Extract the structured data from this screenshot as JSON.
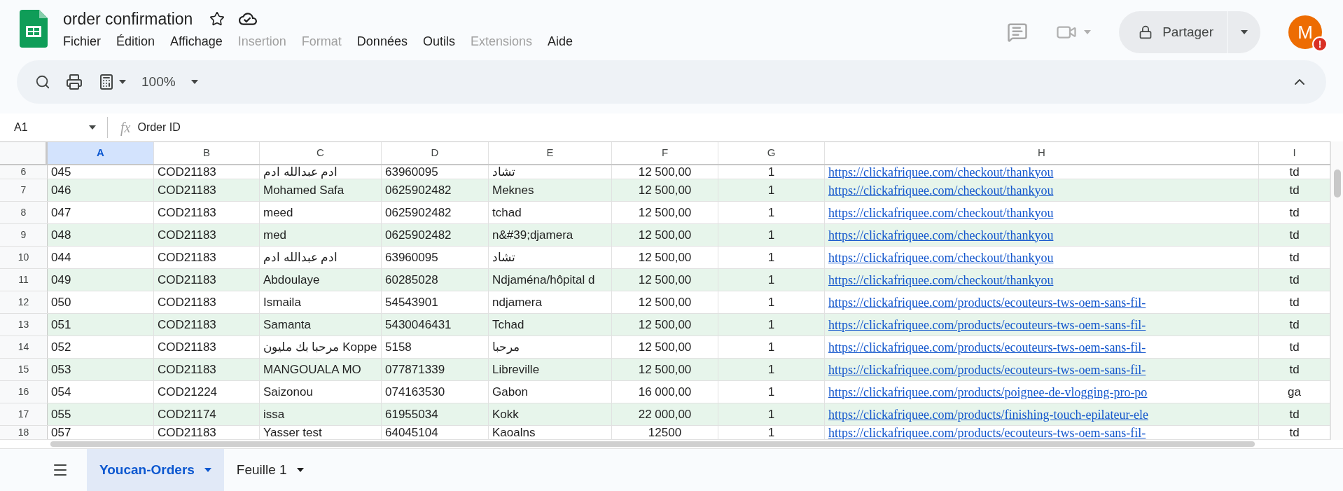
{
  "document": {
    "title": "order confirmation"
  },
  "menu": [
    {
      "label": "Fichier",
      "disabled": false
    },
    {
      "label": "Édition",
      "disabled": false
    },
    {
      "label": "Affichage",
      "disabled": false
    },
    {
      "label": "Insertion",
      "disabled": true
    },
    {
      "label": "Format",
      "disabled": true
    },
    {
      "label": "Données",
      "disabled": false
    },
    {
      "label": "Outils",
      "disabled": false
    },
    {
      "label": "Extensions",
      "disabled": true
    },
    {
      "label": "Aide",
      "disabled": false
    }
  ],
  "share_button": {
    "label": "Partager"
  },
  "account": {
    "initial": "M",
    "alert": "!"
  },
  "toolbar": {
    "zoom": "100%"
  },
  "formula_bar": {
    "cell": "A1",
    "fx": "fx",
    "value": "Order ID"
  },
  "columns": [
    {
      "label": "A",
      "selected": true
    },
    {
      "label": "B",
      "selected": false
    },
    {
      "label": "C",
      "selected": false
    },
    {
      "label": "D",
      "selected": false
    },
    {
      "label": "E",
      "selected": false
    },
    {
      "label": "F",
      "selected": false
    },
    {
      "label": "G",
      "selected": false
    },
    {
      "label": "H",
      "selected": false
    },
    {
      "label": "I",
      "selected": false
    }
  ],
  "rows": [
    {
      "number": "6",
      "cells": [
        "045",
        "COD21183",
        "ادم عبدالله ادم",
        "63960095",
        "تشاد",
        "12 500,00",
        "1",
        "https://clickafriquee.com/checkout/thankyou",
        "td"
      ]
    },
    {
      "number": "7",
      "cells": [
        "046",
        "COD21183",
        "Mohamed Safa",
        "0625902482",
        "Meknes",
        "12 500,00",
        "1",
        "https://clickafriquee.com/checkout/thankyou",
        "td"
      ]
    },
    {
      "number": "8",
      "cells": [
        "047",
        "COD21183",
        "meed",
        "0625902482",
        "tchad",
        "12 500,00",
        "1",
        "https://clickafriquee.com/checkout/thankyou",
        "td"
      ]
    },
    {
      "number": "9",
      "cells": [
        "048",
        "COD21183",
        "med",
        "0625902482",
        "n&#39;djamera",
        "12 500,00",
        "1",
        "https://clickafriquee.com/checkout/thankyou",
        "td"
      ]
    },
    {
      "number": "10",
      "cells": [
        "044",
        "COD21183",
        "ادم عبدالله ادم",
        "63960095",
        "تشاد",
        "12 500,00",
        "1",
        "https://clickafriquee.com/checkout/thankyou",
        "td"
      ]
    },
    {
      "number": "11",
      "cells": [
        "049",
        "COD21183",
        "Abdoulaye",
        "60285028",
        "Ndjaména/hôpital d",
        "12 500,00",
        "1",
        "https://clickafriquee.com/checkout/thankyou",
        "td"
      ]
    },
    {
      "number": "12",
      "cells": [
        "050",
        "COD21183",
        "Ismaila",
        "54543901",
        "ndjamera",
        "12 500,00",
        "1",
        "https://clickafriquee.com/products/ecouteurs-tws-oem-sans-fil-",
        "td"
      ]
    },
    {
      "number": "13",
      "cells": [
        "051",
        "COD21183",
        "Samanta",
        "5430046431",
        "Tchad",
        "12 500,00",
        "1",
        "https://clickafriquee.com/products/ecouteurs-tws-oem-sans-fil-",
        "td"
      ]
    },
    {
      "number": "14",
      "cells": [
        "052",
        "COD21183",
        "مرحبا بك مليون Koppe",
        "5158",
        "مرحبا",
        "12 500,00",
        "1",
        "https://clickafriquee.com/products/ecouteurs-tws-oem-sans-fil-",
        "td"
      ]
    },
    {
      "number": "15",
      "cells": [
        "053",
        "COD21183",
        "MANGOUALA MO",
        "077871339",
        "Libreville",
        "12 500,00",
        "1",
        "https://clickafriquee.com/products/ecouteurs-tws-oem-sans-fil-",
        "td"
      ]
    },
    {
      "number": "16",
      "cells": [
        "054",
        "COD21224",
        "Saizonou",
        "074163530",
        "Gabon",
        "16 000,00",
        "1",
        "https://clickafriquee.com/products/poignee-de-vlogging-pro-po",
        "ga"
      ]
    },
    {
      "number": "17",
      "cells": [
        "055",
        "COD21174",
        "issa",
        "61955034",
        "Kokk",
        "22 000,00",
        "1",
        "https://clickafriquee.com/products/finishing-touch-epilateur-ele",
        "td"
      ]
    },
    {
      "number": "18",
      "cells": [
        "057",
        "COD21183",
        "Yasser test",
        "64045104",
        "Kaoalns",
        "12500",
        "1",
        "https://clickafriquee.com/products/ecouteurs-tws-oem-sans-fil-",
        "td"
      ]
    }
  ],
  "sheet_tabs": [
    {
      "label": "Youcan-Orders",
      "selected": true
    },
    {
      "label": "Feuille 1",
      "selected": false
    }
  ]
}
